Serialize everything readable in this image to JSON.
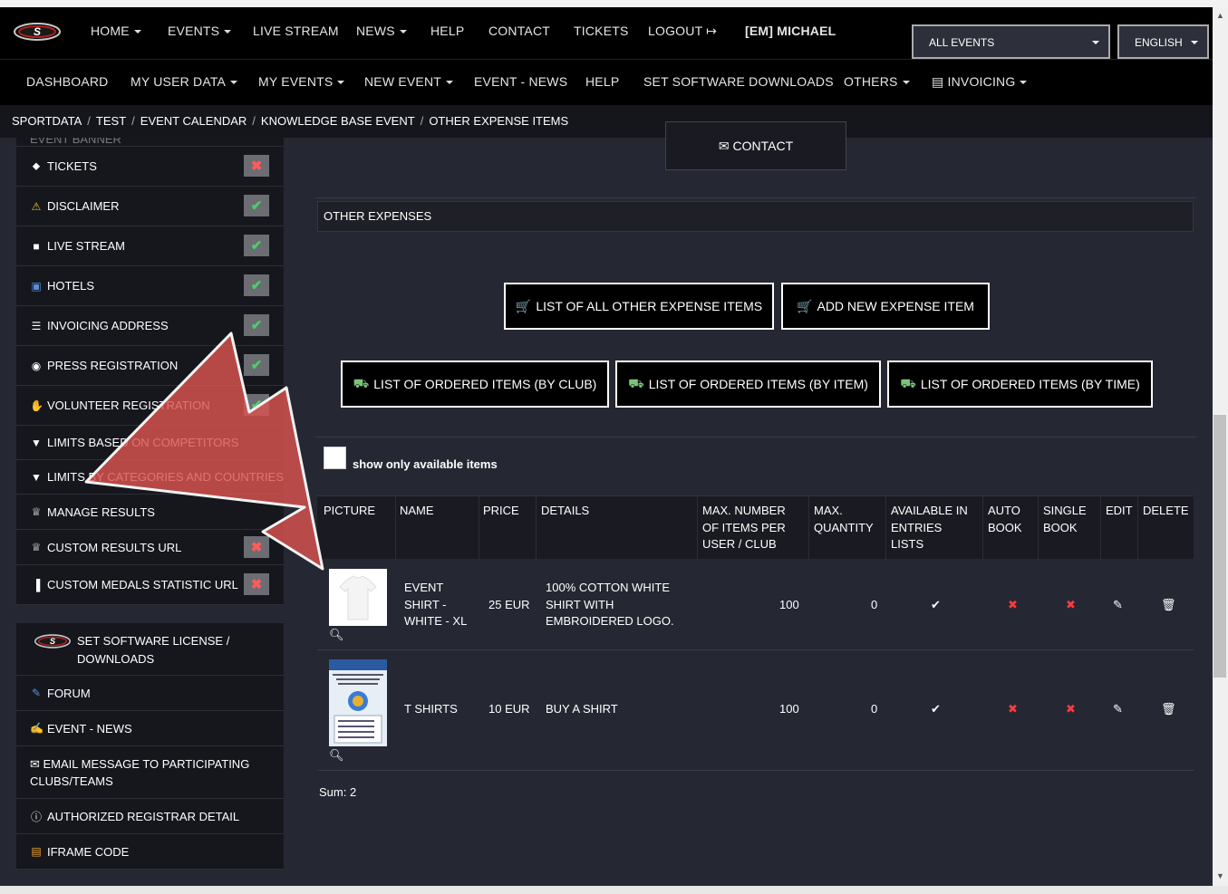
{
  "nav": {
    "items": [
      {
        "label": "HOME",
        "caret": true
      },
      {
        "label": "EVENTS",
        "caret": true
      },
      {
        "label": "LIVE STREAM",
        "caret": false
      },
      {
        "label": "NEWS",
        "caret": true
      },
      {
        "label": "HELP",
        "caret": false
      },
      {
        "label": "CONTACT",
        "caret": false
      },
      {
        "label": "TICKETS",
        "caret": false
      },
      {
        "label": "LOGOUT",
        "caret": false
      },
      {
        "label": "[EM] MICHAEL",
        "caret": false
      }
    ],
    "event_select": "ALL EVENTS",
    "language_select": "ENGLISH"
  },
  "subnav": {
    "items": [
      {
        "label": "DASHBOARD"
      },
      {
        "label": "MY USER DATA"
      },
      {
        "label": "MY EVENTS"
      },
      {
        "label": "NEW EVENT"
      },
      {
        "label": "EVENT - NEWS"
      },
      {
        "label": "HELP"
      },
      {
        "label": "SET SOFTWARE DOWNLOADS"
      },
      {
        "label": "OTHERS"
      },
      {
        "label": "INVOICING"
      }
    ]
  },
  "breadcrumb": [
    "SPORTDATA",
    "TEST",
    "EVENT CALENDAR",
    "KNOWLEDGE BASE EVENT",
    "OTHER EXPENSE ITEMS"
  ],
  "sidebar": {
    "partial_item": "EVENT BANNER",
    "items": [
      {
        "label": "TICKETS",
        "icon": "ticket-icon",
        "status": "no"
      },
      {
        "label": "DISCLAIMER",
        "icon": "warning-icon",
        "status": "ok"
      },
      {
        "label": "LIVE STREAM",
        "icon": "video-camera-icon",
        "status": "ok"
      },
      {
        "label": "HOTELS",
        "icon": "suitcase-icon",
        "status": "ok"
      },
      {
        "label": "INVOICING ADDRESS",
        "icon": "document-icon",
        "status": "ok"
      },
      {
        "label": "PRESS REGISTRATION",
        "icon": "camera-icon",
        "status": "ok"
      },
      {
        "label": "VOLUNTEER REGISTRATION",
        "icon": "hand-icon",
        "status": "ok"
      },
      {
        "label": "LIMITS BASED ON COMPETITORS",
        "icon": "filter-icon",
        "status": ""
      },
      {
        "label": "LIMITS BY CATEGORIES AND COUNTRIES",
        "icon": "filter-icon",
        "status": ""
      },
      {
        "label": "MANAGE RESULTS",
        "icon": "trophy-icon",
        "status": ""
      },
      {
        "label": "CUSTOM RESULTS URL",
        "icon": "trophy-icon",
        "status": "no"
      },
      {
        "label": "CUSTOM MEDALS STATISTIC URL",
        "icon": "bar-chart-icon",
        "status": "no"
      }
    ],
    "group2": [
      {
        "label": "SET SOFTWARE LICENSE / DOWNLOADS",
        "icon": "sportdata-logo-icon"
      },
      {
        "label": "FORUM",
        "icon": "forum-icon"
      },
      {
        "label": "EVENT - NEWS",
        "icon": "megaphone-icon"
      },
      {
        "label": "EMAIL MESSAGE TO PARTICIPATING CLUBS/TEAMS",
        "icon": "envelope-icon"
      },
      {
        "label": "AUTHORIZED REGISTRAR DETAIL",
        "icon": "info-icon"
      },
      {
        "label": "IFRAME CODE",
        "icon": "code-icon"
      }
    ]
  },
  "main": {
    "contact_label": "CONTACT",
    "section_title": "OTHER EXPENSES",
    "buttons_row1": [
      "LIST OF ALL OTHER EXPENSE ITEMS",
      "ADD NEW EXPENSE ITEM"
    ],
    "buttons_row2": [
      "LIST OF ORDERED ITEMS (BY CLUB)",
      "LIST OF ORDERED ITEMS (BY ITEM)",
      "LIST OF ORDERED ITEMS (BY TIME)"
    ],
    "filter_label": "show only available items",
    "table": {
      "headers": [
        "PICTURE",
        "NAME",
        "PRICE",
        "DETAILS",
        "MAX. NUMBER OF ITEMS PER USER / CLUB",
        "MAX. QUANTITY",
        "AVAILABLE IN ENTRIES LISTS",
        "AUTO BOOK",
        "SINGLE BOOK",
        "EDIT",
        "DELETE"
      ],
      "rows": [
        {
          "picture": "white-tshirt-image",
          "name": "EVENT SHIRT - WHITE - XL",
          "price": "25 EUR",
          "details": "100% COTTON WHITE SHIRT WITH EMBROIDERED LOGO.",
          "max_per_user": "100",
          "max_quantity": "0",
          "available": true,
          "auto_book": false,
          "single_book": false
        },
        {
          "picture": "poster-image",
          "name": "T SHIRTS",
          "price": "10 EUR",
          "details": "BUY A SHIRT",
          "max_per_user": "100",
          "max_quantity": "0",
          "available": true,
          "auto_book": false,
          "single_book": false
        }
      ]
    },
    "sum_label": "Sum: 2"
  },
  "colors": {
    "background": "#252733",
    "nav": "#000000",
    "ok": "#4ccf6a",
    "no": "#ff5b5b",
    "pointer": "#d9534f"
  }
}
